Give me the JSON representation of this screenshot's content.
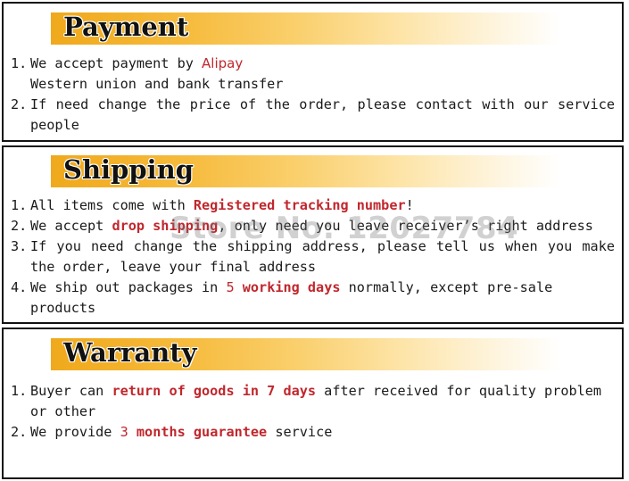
{
  "document": {
    "watermark": "Store No: 12027784",
    "accent_color": "#f0a91c",
    "highlight_color": "#c0272d",
    "text_color": "#1a1a1a"
  },
  "sections": [
    {
      "id": "payment",
      "title": "Payment",
      "items": [
        {
          "number": "1.",
          "parts": [
            {
              "text": "We accept payment by ",
              "style": "normal"
            },
            {
              "text": "Alipay",
              "style": "alipay"
            },
            {
              "text": "\nWestern union and bank transfer",
              "style": "normal"
            }
          ],
          "plain": "We accept payment by Alipay Western union and bank transfer"
        },
        {
          "number": "2.",
          "parts": [
            {
              "text": "If need change the price of the order, please contact with our service people",
              "style": "normal"
            }
          ],
          "plain": "If need change the price of the order, please contact with our service people"
        }
      ]
    },
    {
      "id": "shipping",
      "title": "Shipping",
      "items": [
        {
          "number": "1.",
          "parts": [
            {
              "text": "All items come with ",
              "style": "normal"
            },
            {
              "text": "Registered tracking number",
              "style": "highlight"
            },
            {
              "text": "!",
              "style": "normal"
            }
          ],
          "plain": "All items come with Registered tracking number!"
        },
        {
          "number": "2.",
          "parts": [
            {
              "text": "We accept ",
              "style": "normal"
            },
            {
              "text": "drop shipping",
              "style": "highlight"
            },
            {
              "text": ", only need you leave receiver’s right address",
              "style": "normal"
            }
          ],
          "plain": "We accept drop shipping, only need you leave receiver’s right address"
        },
        {
          "number": "3.",
          "parts": [
            {
              "text": "If you need change the shipping address, please tell us when you make the order, leave your final address",
              "style": "normal"
            }
          ],
          "plain": "If you need change the shipping address, please tell us when you make the order, leave your final address"
        },
        {
          "number": "4.",
          "parts": [
            {
              "text": "We ship out packages in ",
              "style": "normal"
            },
            {
              "text": "5",
              "style": "highlight-thin"
            },
            {
              "text": " ",
              "style": "normal"
            },
            {
              "text": "working days",
              "style": "highlight"
            },
            {
              "text": " normally, except pre-sale products",
              "style": "normal"
            }
          ],
          "plain": "We ship out packages in 5 working days normally, except pre-sale products"
        }
      ]
    },
    {
      "id": "warranty",
      "title": "Warranty",
      "items": [
        {
          "number": "1.",
          "parts": [
            {
              "text": "Buyer can ",
              "style": "normal"
            },
            {
              "text": "return of goods in 7 days",
              "style": "highlight"
            },
            {
              "text": " after received for quality problem or other",
              "style": "normal"
            }
          ],
          "plain": "Buyer can return of goods in 7 days after received for quality problem or other"
        },
        {
          "number": "2.",
          "parts": [
            {
              "text": "We provide ",
              "style": "normal"
            },
            {
              "text": "3",
              "style": "highlight-thin"
            },
            {
              "text": " ",
              "style": "normal"
            },
            {
              "text": "months guarantee",
              "style": "highlight"
            },
            {
              "text": " service",
              "style": "normal"
            }
          ],
          "plain": "We provide 3 months guarantee service"
        }
      ]
    }
  ]
}
